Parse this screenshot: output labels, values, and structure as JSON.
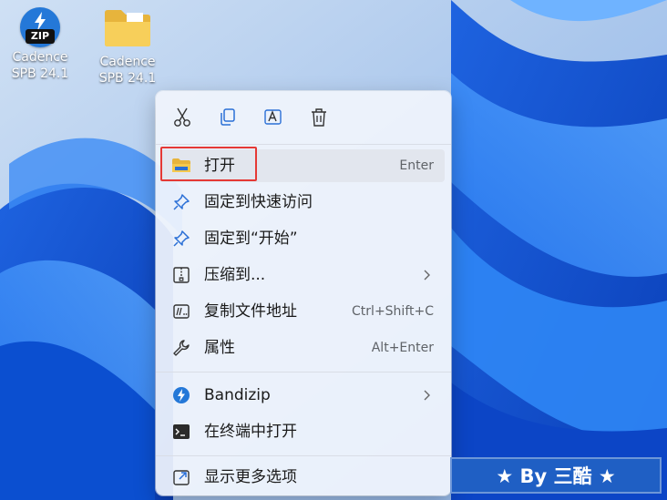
{
  "desktop": {
    "icons": [
      {
        "label_line1": "Cadence",
        "label_line2": "SPB 24.1",
        "badge": "ZIP",
        "icon": "bandizip-archive-icon"
      },
      {
        "label_line1": "Cadence",
        "label_line2": "SPB 24.1",
        "icon": "folder-icon"
      }
    ]
  },
  "context_menu": {
    "toolbar": [
      {
        "icon": "cut-icon"
      },
      {
        "icon": "copy-icon"
      },
      {
        "icon": "rename-icon"
      },
      {
        "icon": "delete-icon"
      }
    ],
    "items": [
      {
        "label": "打开",
        "shortcut": "Enter",
        "icon": "folder-open-icon"
      },
      {
        "label": "固定到快速访问",
        "icon": "pin-icon"
      },
      {
        "label": "固定到“开始”",
        "icon": "pin-icon"
      },
      {
        "label": "压缩到...",
        "icon": "zip-folder-icon",
        "submenu": true
      },
      {
        "label": "复制文件地址",
        "shortcut": "Ctrl+Shift+C",
        "icon": "copy-path-icon"
      },
      {
        "label": "属性",
        "shortcut": "Alt+Enter",
        "icon": "wrench-icon"
      },
      {
        "label": "Bandizip",
        "icon": "bandizip-icon",
        "submenu": true
      },
      {
        "label": "在终端中打开",
        "icon": "terminal-icon"
      },
      {
        "label": "显示更多选项",
        "icon": "show-more-icon"
      }
    ]
  },
  "watermark": {
    "text": "★ By 三酷 ★"
  },
  "colors": {
    "accent": "#1f5fc4",
    "highlight": "#e53935",
    "menu_bg": "#f0f4fc"
  }
}
